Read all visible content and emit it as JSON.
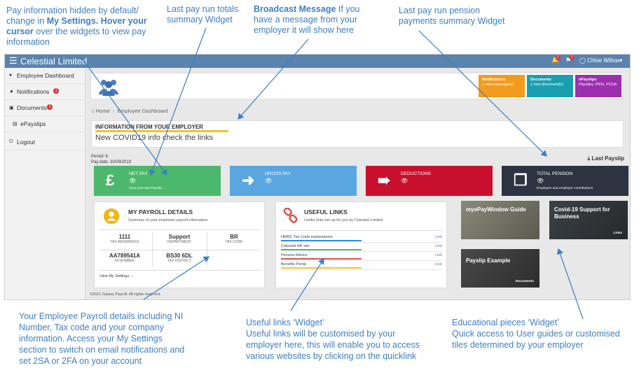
{
  "annotations": {
    "pay_hidden": {
      "line1": "Pay information hidden by default/",
      "line2a": "change in ",
      "line2b": "My Settings. Hover your",
      "line3a": "cursor",
      "line3b": " over the widgets to view pay",
      "line4": "information"
    },
    "pay_run_totals": {
      "line1": "Last pay run totals",
      "line2": "summary Widget"
    },
    "broadcast": {
      "bold": "Broadcast Message",
      "line1": " If you",
      "line2": "have a message from your",
      "line3": "employer it will show here"
    },
    "pension": {
      "line1": "Last pay run pension",
      "line2": "payments summary Widget"
    },
    "payroll_details": {
      "line1": "Your Employee Payroll details including NI",
      "line2": "Number, Tax code and your company",
      "line3": "information. Access your My Settings",
      "line4": "section to switch on email notifications and",
      "line5": "set 2SA or 2FA on your account"
    },
    "useful_links": {
      "line1": "Useful links ‘Widget’",
      "line2": "Useful links will be customised by your",
      "line3": "employer here, this will enable you to access",
      "line4": "various websites by clicking on the quicklink"
    },
    "educational": {
      "line1": "Educational pieces ‘Widget’",
      "line2": "Quick access to User guides or customised",
      "line3": "tiles determined by your employer"
    }
  },
  "app": {
    "brand": "Celestial Limited",
    "menu_icon": "hamburger-icon",
    "topbar": {
      "bell_badge": "1",
      "flag_badge": "1",
      "user_name": "Chloe Willow",
      "user_caret": "▾"
    },
    "sidebar": {
      "items": [
        {
          "label": "Employee Dashboard",
          "icon": "user-icon"
        },
        {
          "label": "Notifications",
          "icon": "bell-icon",
          "badge": "1"
        },
        {
          "label": "Documents",
          "icon": "document-icon",
          "badge": "1"
        },
        {
          "label": "ePayslips",
          "icon": "payslip-icon"
        },
        {
          "label": "Logout",
          "icon": "power-icon"
        }
      ]
    },
    "tiles": [
      {
        "title": "Notifications",
        "sub": "1 new message(s)",
        "color": "#f29b1d"
      },
      {
        "title": "Documents",
        "sub": "1 new document(s)",
        "color": "#1a9fb1"
      },
      {
        "title": "ePayslips",
        "sub": "Payslips, P60s, P11ds",
        "color": "#9b2fae"
      }
    ],
    "breadcrumb": {
      "home": "Home",
      "separator": "›",
      "current": "Employee Dashboard"
    },
    "info": {
      "title": "INFORMATION FROM YOUR EMPLOYER",
      "message": "New COVID19 info check the links"
    },
    "period": {
      "period": "Period: 6",
      "pay_date": "Pay date: 30/09/2019"
    },
    "last_payslip": "Last Payslip",
    "summary_cards": [
      {
        "label": "NET PAY",
        "sub": "View your last Payslip →",
        "icon_glyph": "£",
        "color": "#4cb86b"
      },
      {
        "label": "GROSS PAY",
        "sub": "",
        "icon_glyph": "➜",
        "color": "#5aa6e0"
      },
      {
        "label": "DEDUCTIONS",
        "sub": "",
        "icon_glyph": "➠",
        "color": "#c8102e"
      },
      {
        "label": "TOTAL PENSION",
        "sub": "Employee and employer contributions",
        "icon_glyph": "❒",
        "color": "#2b3440"
      }
    ],
    "eye_glyph": "👁",
    "payroll": {
      "title": "MY PAYROLL DETAILS",
      "subtitle": "Summary of your employee payroll information",
      "cells": [
        {
          "value": "1111",
          "key": "TAX REFERENCE"
        },
        {
          "value": "Support",
          "key": "DEPARTMENT"
        },
        {
          "value": "BR",
          "key": "TAX CODE"
        },
        {
          "value": "AA789541A",
          "key": "NI NUMBER"
        },
        {
          "value": "BS30 6DL",
          "key": "TAX DISTRICT"
        }
      ],
      "settings_link": "View My Settings →"
    },
    "useful": {
      "title": "USEFUL LINKS",
      "subtitle": "Useful links set up for you by Celestial Limited",
      "links": [
        {
          "label": "HMRC Tax Code explanations",
          "link": "Link",
          "color": "#2a8fd6"
        },
        {
          "label": "Celestial HR site",
          "link": "Link",
          "color": "#4cb86b"
        },
        {
          "label": "Pension Advice",
          "link": "Link",
          "color": "#d9534f"
        },
        {
          "label": "Benefits Portal",
          "link": "Link",
          "color": "#f1c232"
        }
      ]
    },
    "education": [
      {
        "title": "myePayWindow Guide",
        "tag": "",
        "color": "#7a7a6a"
      },
      {
        "title": "Covid-19 Support for Business",
        "tag": "Links",
        "color": "#2e3438"
      },
      {
        "title": "Payslip Example",
        "tag": "Documents",
        "color": "#3d3d3d"
      }
    ],
    "footer": "©2021 Galaxy Payroll. All rights reserved."
  }
}
